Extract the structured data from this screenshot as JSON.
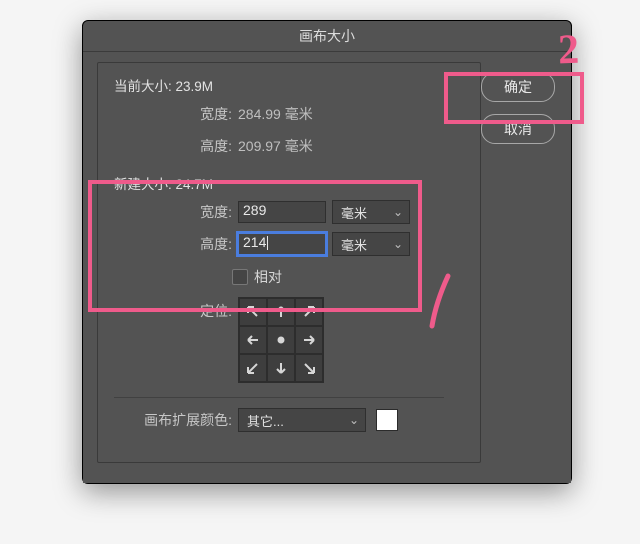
{
  "window": {
    "title": "画布大小"
  },
  "buttons": {
    "ok": "确定",
    "cancel": "取消"
  },
  "current": {
    "title_prefix": "当前大小:",
    "size": "23.9M",
    "width_label": "宽度:",
    "width_value": "284.99 毫米",
    "height_label": "高度:",
    "height_value": "209.97 毫米"
  },
  "newsize": {
    "title_prefix": "新建大小:",
    "size": "24.7M",
    "width_label": "宽度:",
    "width_value": "289",
    "height_label": "高度:",
    "height_value": "214",
    "unit": "毫米",
    "relative_label": "相对",
    "anchor_label": "定位:"
  },
  "extension": {
    "label": "画布扩展颜色:",
    "value": "其它...",
    "swatch": "#ffffff"
  },
  "annotations": {
    "num2": "2"
  }
}
